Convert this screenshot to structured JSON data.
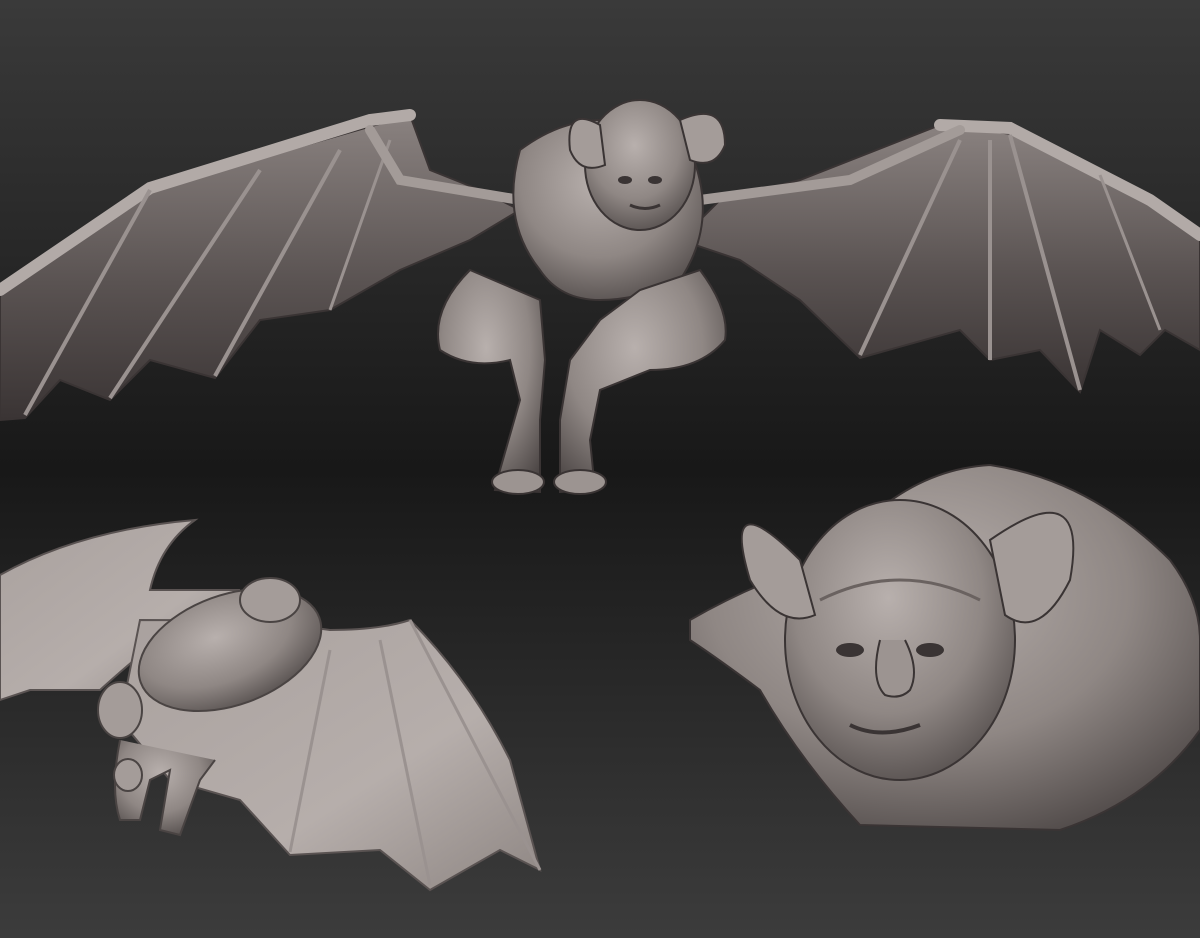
{
  "viewport": {
    "background_top": "#3a3a3a",
    "background_mid": "#181818",
    "background_bottom": "#3c3c3c"
  },
  "material": {
    "clay_light": "#b8b0ad",
    "clay_mid": "#8f8784",
    "clay_dark": "#4a4443",
    "clay_shadow": "#2a2626"
  },
  "views": [
    {
      "name": "front-full-body-view"
    },
    {
      "name": "rear-three-quarter-view"
    },
    {
      "name": "head-bust-closeup-view"
    }
  ]
}
